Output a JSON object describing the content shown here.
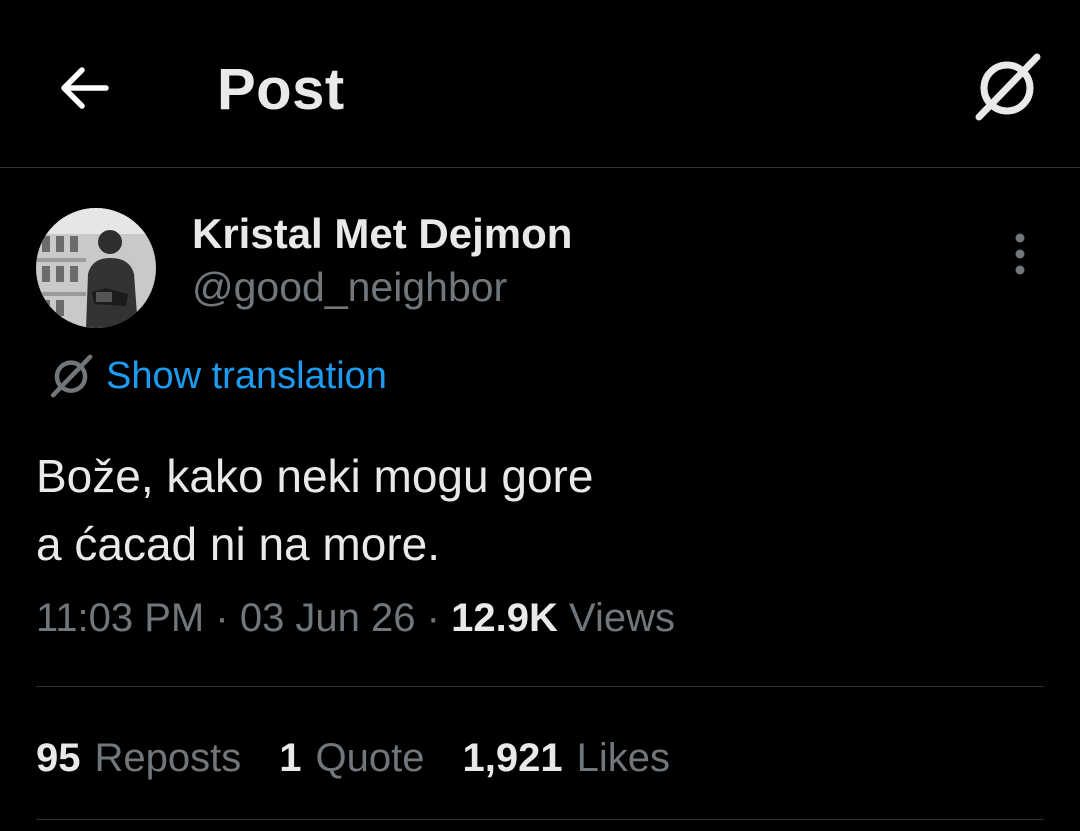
{
  "header": {
    "title": "Post",
    "back_icon": "arrow-left-icon",
    "translate_icon": "grok-icon"
  },
  "author": {
    "display_name": "Kristal Met Dejmon",
    "handle": "@good_neighbor",
    "avatar_icon": "avatar-photo"
  },
  "post": {
    "show_translation_label": "Show translation",
    "text_lines": [
      "Bože, kako neki mogu gore",
      "a ćacad ni na more."
    ],
    "time": "11:03 PM",
    "sep": "·",
    "date": "03 Jun 26",
    "views_count": "12.9K",
    "views_label": "Views"
  },
  "stats": {
    "reposts_count": "95",
    "reposts_label": "Reposts",
    "quotes_count": "1",
    "quotes_label": "Quote",
    "likes_count": "1,921",
    "likes_label": "Likes"
  },
  "colors": {
    "background": "#000000",
    "primary_text": "#e7e9ea",
    "secondary_text": "#71767b",
    "link": "#1d9bf0",
    "divider": "#2f3336"
  }
}
